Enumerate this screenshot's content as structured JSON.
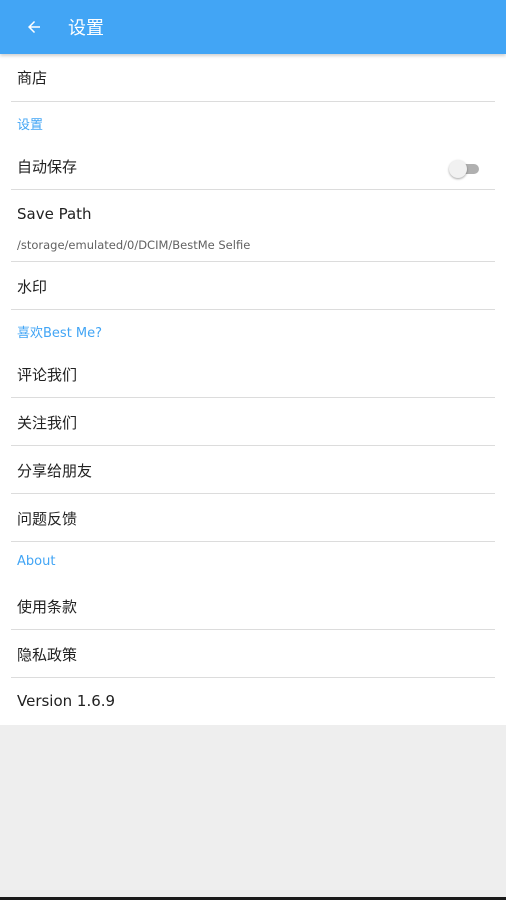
{
  "appbar": {
    "title": "设置",
    "back_icon": "arrow-left-icon",
    "color": "#42a5f5"
  },
  "items": {
    "store": "商店",
    "section_settings": "设置",
    "autosave": {
      "label": "自动保存",
      "enabled": false
    },
    "save_path": {
      "label": "Save Path",
      "value": "/storage/emulated/0/DCIM/BestMe Selfie"
    },
    "watermark": "水印",
    "section_like": "喜欢Best Me?",
    "rate": "评论我们",
    "follow": "关注我们",
    "share": "分享给朋友",
    "feedback": "问题反馈",
    "section_about": "About",
    "terms": "使用条款",
    "privacy": "隐私政策",
    "version": "Version 1.6.9"
  },
  "colors": {
    "accent": "#42a5f5",
    "divider": "#dcdcdc",
    "background": "#eeeeee"
  }
}
